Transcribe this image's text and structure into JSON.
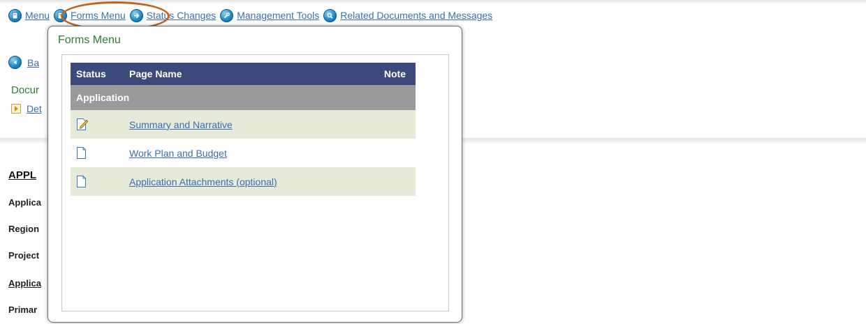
{
  "nav": {
    "items": [
      {
        "label": "Menu",
        "icon": "document-icon"
      },
      {
        "label": "Forms Menu",
        "icon": "document-icon"
      },
      {
        "label": "Status Changes",
        "icon": "arrow-right-icon"
      },
      {
        "label": "Management Tools",
        "icon": "wrench-icon"
      },
      {
        "label": "Related Documents and Messages",
        "icon": "magnifier-icon"
      }
    ]
  },
  "page": {
    "back_label": "Ba",
    "document_label": "Docur",
    "details_link": "Det",
    "section_heading": "APPL",
    "fields": [
      "Applica",
      "Region",
      "Project",
      "Applica",
      "Primar"
    ]
  },
  "popup": {
    "title": "Forms Menu",
    "columns": {
      "status": "Status",
      "page_name": "Page Name",
      "note": "Note"
    },
    "section": "Application",
    "rows": [
      {
        "page_name": "Summary and Narrative",
        "status_icon": "edit-document-icon"
      },
      {
        "page_name": "Work Plan and Budget",
        "status_icon": "blank-document-icon"
      },
      {
        "page_name": "Application Attachments (optional)",
        "status_icon": "blank-document-icon"
      }
    ]
  },
  "colors": {
    "link": "#3b6fb0",
    "accent_green": "#2e7d32",
    "table_header": "#3a4a7a",
    "section_header": "#9a9a9a",
    "row_alt": "#e5ead9",
    "highlight_ring": "#c0651e"
  }
}
